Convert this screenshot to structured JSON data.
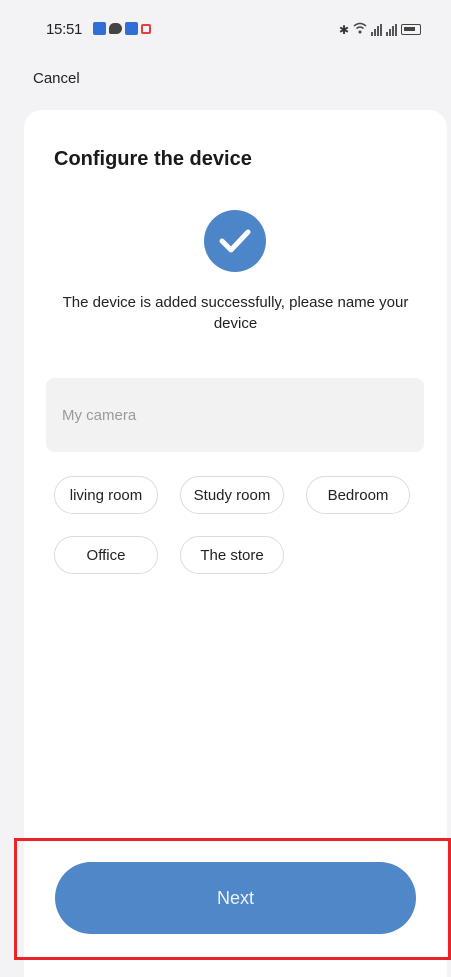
{
  "status_bar": {
    "time": "15:51"
  },
  "header": {
    "cancel_label": "Cancel"
  },
  "card": {
    "title": "Configure the device",
    "success_message": "The device is added successfully, please name your device",
    "name_input": {
      "placeholder": "My camera",
      "value": ""
    },
    "room_chips": [
      "living room",
      "Study room",
      "Bedroom",
      "Office",
      "The store"
    ]
  },
  "footer": {
    "next_label": "Next"
  },
  "colors": {
    "accent": "#4f87c9",
    "check_circle": "#4d86c8",
    "highlight_border": "#e8232a",
    "background": "#f3f3f5",
    "input_bg": "#f2f2f2"
  },
  "icons": {
    "success": "check-circle-icon",
    "status_icons": [
      "notification-square-icon",
      "chat-icon",
      "app-icon",
      "mail-icon",
      "bluetooth-icon",
      "wifi-icon",
      "signal-icon",
      "battery-icon"
    ]
  }
}
